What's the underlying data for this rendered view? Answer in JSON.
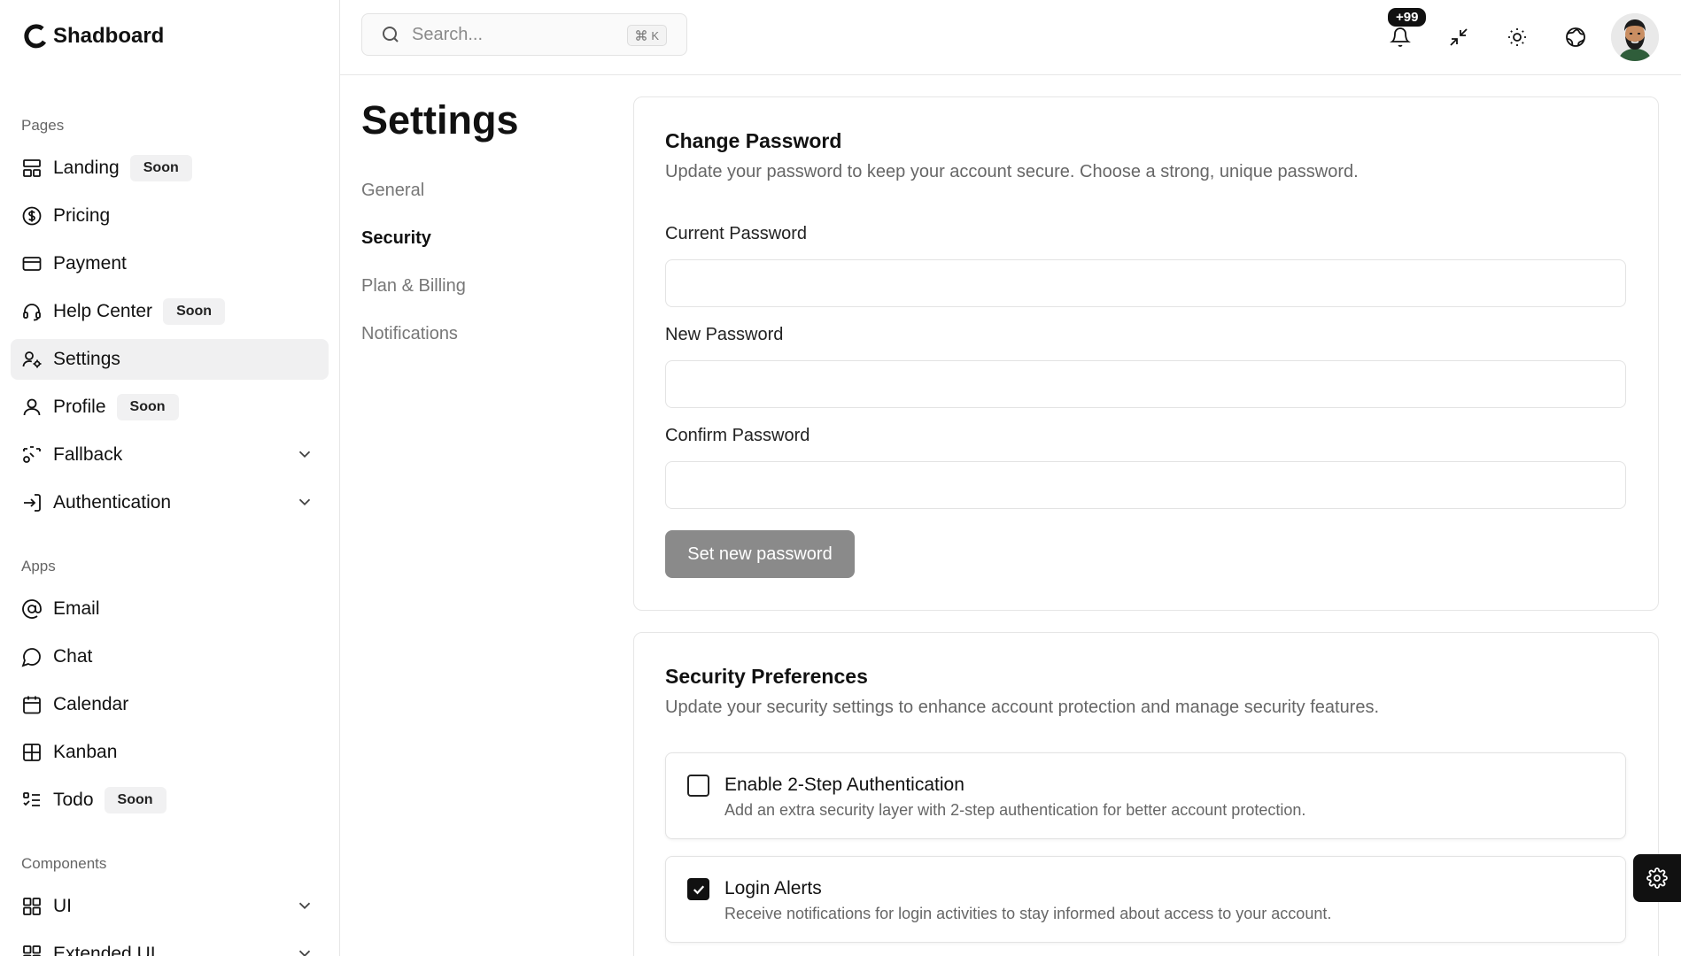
{
  "app": {
    "logo_text": "Shadboard"
  },
  "sidebar": {
    "sections": {
      "pages": "Pages",
      "apps": "Apps",
      "components": "Components"
    },
    "pages": [
      {
        "label": "Landing",
        "badge": "Soon",
        "icon": "layout-icon"
      },
      {
        "label": "Pricing",
        "icon": "dollar-circle-icon"
      },
      {
        "label": "Payment",
        "icon": "credit-card-icon"
      },
      {
        "label": "Help Center",
        "badge": "Soon",
        "icon": "headset-icon"
      },
      {
        "label": "Settings",
        "icon": "user-cog-icon",
        "active": true
      },
      {
        "label": "Profile",
        "badge": "Soon",
        "icon": "user-icon"
      },
      {
        "label": "Fallback",
        "icon": "fallback-icon",
        "expandable": true
      },
      {
        "label": "Authentication",
        "icon": "login-icon",
        "expandable": true
      }
    ],
    "apps": [
      {
        "label": "Email",
        "icon": "at-sign-icon"
      },
      {
        "label": "Chat",
        "icon": "chat-bubble-icon"
      },
      {
        "label": "Calendar",
        "icon": "calendar-icon"
      },
      {
        "label": "Kanban",
        "icon": "kanban-icon"
      },
      {
        "label": "Todo",
        "badge": "Soon",
        "icon": "todo-list-icon"
      }
    ],
    "components": [
      {
        "label": "UI",
        "icon": "grid-icon",
        "expandable": true
      },
      {
        "label": "Extended UI",
        "icon": "grid-icon",
        "expandable": true
      }
    ]
  },
  "header": {
    "search_placeholder": "Search...",
    "search_shortcut_key": "K",
    "notification_count": "+99",
    "icons": [
      "bell-icon",
      "minimize-icon",
      "sun-icon",
      "globe-icon",
      "avatar"
    ]
  },
  "settings": {
    "title": "Settings",
    "subnav": [
      {
        "label": "General"
      },
      {
        "label": "Security",
        "active": true
      },
      {
        "label": "Plan & Billing"
      },
      {
        "label": "Notifications"
      }
    ]
  },
  "change_password": {
    "title": "Change Password",
    "description": "Update your password to keep your account secure. Choose a strong, unique password.",
    "fields": [
      {
        "label": "Current Password",
        "value": ""
      },
      {
        "label": "New Password",
        "value": ""
      },
      {
        "label": "Confirm Password",
        "value": ""
      }
    ],
    "submit_label": "Set new password"
  },
  "security_preferences": {
    "title": "Security Preferences",
    "description": "Update your security settings to enhance account protection and manage security features.",
    "options": [
      {
        "title": "Enable 2-Step Authentication",
        "description": "Add an extra security layer with 2-step authentication for better account protection.",
        "checked": false
      },
      {
        "title": "Login Alerts",
        "description": "Receive notifications for login activities to stay informed about access to your account.",
        "checked": true
      }
    ]
  },
  "colors": {
    "primary_disabled": "#8a8a8a",
    "active_nav_bg": "#f0f0f1",
    "border": "#e6e6e6",
    "text_muted": "#666666"
  }
}
